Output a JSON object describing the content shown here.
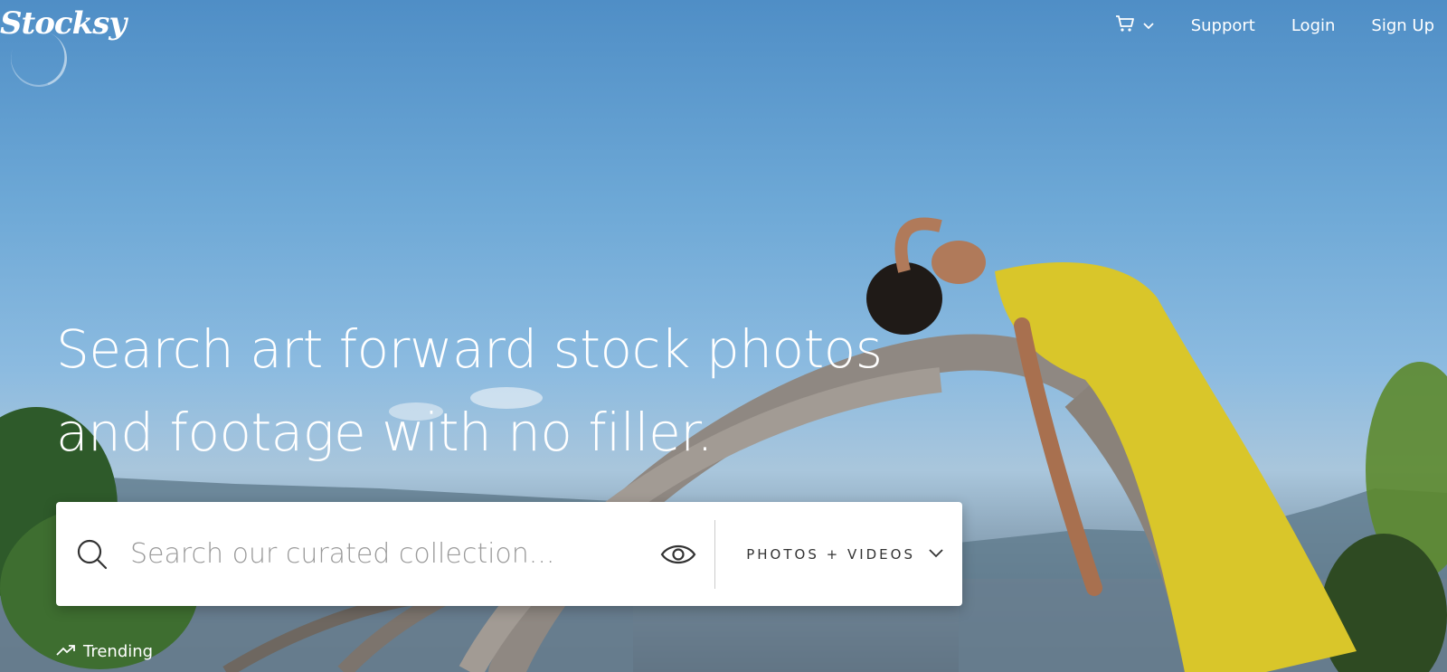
{
  "brand": {
    "logo_text": "Stocksy"
  },
  "nav": {
    "cart_icon": "cart-icon",
    "items": [
      {
        "label": "Support"
      },
      {
        "label": "Login"
      },
      {
        "label": "Sign Up"
      }
    ]
  },
  "hero": {
    "headline_line1": "Search art forward stock photos",
    "headline_line2": "and footage with no filler."
  },
  "search": {
    "placeholder": "Search our curated collection...",
    "value": "",
    "media_type": "PHOTOS + VIDEOS"
  },
  "trending": {
    "label": "Trending"
  },
  "colors": {
    "sky": "#6da8d6",
    "dress": "#d9c62a",
    "text": "#ffffff"
  }
}
